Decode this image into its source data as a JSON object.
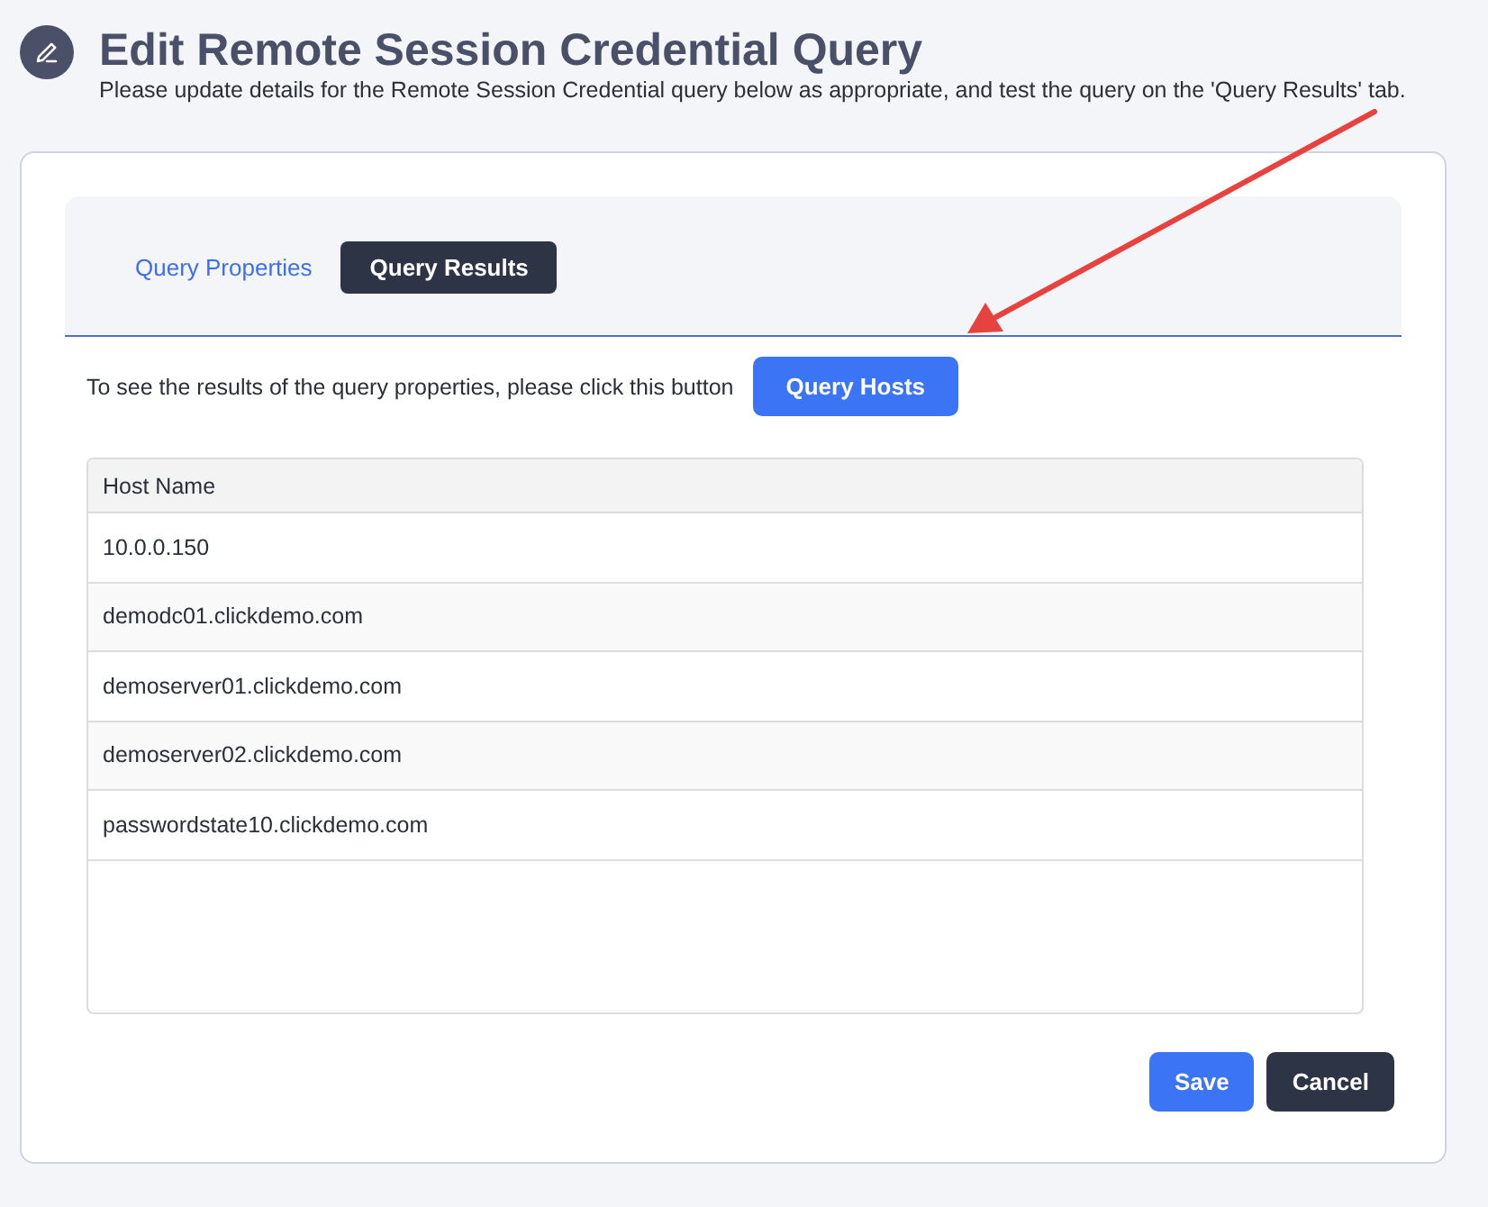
{
  "header": {
    "title": "Edit Remote Session Credential Query",
    "subtitle": "Please update details for the Remote Session Credential query below as appropriate, and test the query on the 'Query Results' tab."
  },
  "tabs": [
    {
      "label": "Query Properties",
      "selected": false
    },
    {
      "label": "Query Results",
      "selected": true
    }
  ],
  "query_prompt": {
    "text": "To see the results of the query properties, please click this button",
    "button": "Query Hosts"
  },
  "table": {
    "columns": [
      "Host Name"
    ],
    "rows": [
      [
        "10.0.0.150"
      ],
      [
        "demodc01.clickdemo.com"
      ],
      [
        "demoserver01.clickdemo.com"
      ],
      [
        "demoserver02.clickdemo.com"
      ],
      [
        "passwordstate10.clickdemo.com"
      ]
    ]
  },
  "buttons": [
    {
      "label": "Save",
      "kind": "primary"
    },
    {
      "label": "Cancel",
      "kind": "secondary"
    }
  ]
}
